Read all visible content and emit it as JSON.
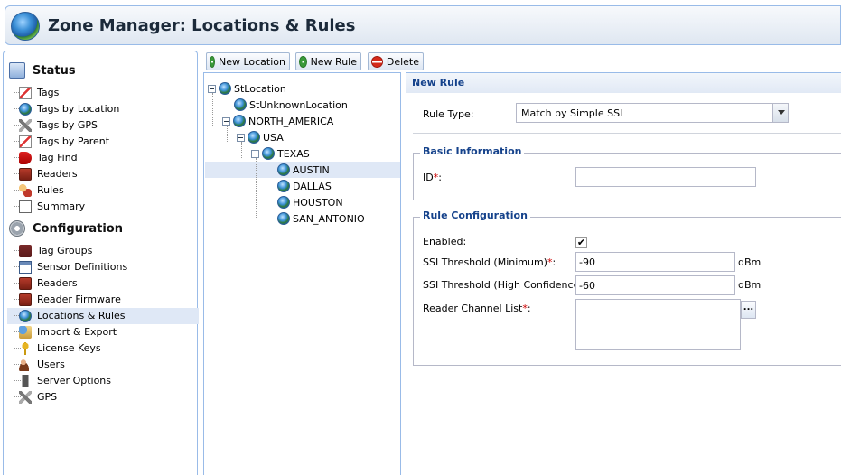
{
  "header": {
    "title": "Zone Manager: Locations & Rules",
    "logo_icon": "globe-icon"
  },
  "sidebar": {
    "status": {
      "title": "Status",
      "items": [
        {
          "label": "Tags",
          "icon": "tag-icon"
        },
        {
          "label": "Tags by Location",
          "icon": "globe-icon"
        },
        {
          "label": "Tags by GPS",
          "icon": "satellite-icon"
        },
        {
          "label": "Tags by Parent",
          "icon": "tag-icon"
        },
        {
          "label": "Tag Find",
          "icon": "tag-find-icon"
        },
        {
          "label": "Readers",
          "icon": "reader-icon"
        },
        {
          "label": "Rules",
          "icon": "rules-icon"
        },
        {
          "label": "Summary",
          "icon": "document-icon"
        }
      ]
    },
    "configuration": {
      "title": "Configuration",
      "items": [
        {
          "label": "Tag Groups",
          "icon": "tag-group-icon"
        },
        {
          "label": "Sensor Definitions",
          "icon": "sensor-icon"
        },
        {
          "label": "Readers",
          "icon": "reader-icon"
        },
        {
          "label": "Reader Firmware",
          "icon": "reader-icon"
        },
        {
          "label": "Locations & Rules",
          "icon": "globe-icon",
          "selected": true
        },
        {
          "label": "Import & Export",
          "icon": "import-export-icon"
        },
        {
          "label": "License Keys",
          "icon": "key-icon"
        },
        {
          "label": "Users",
          "icon": "users-icon"
        },
        {
          "label": "Server Options",
          "icon": "server-icon"
        },
        {
          "label": "GPS",
          "icon": "satellite-icon"
        }
      ]
    }
  },
  "toolbar": {
    "new_location_label": "New Location",
    "new_rule_label": "New Rule",
    "delete_label": "Delete"
  },
  "tree": {
    "root": "StLocation",
    "unknown": "StUnknownLocation",
    "north_america": "NORTH_AMERICA",
    "usa": "USA",
    "texas": "TEXAS",
    "cities": [
      "AUSTIN",
      "DALLAS",
      "HOUSTON",
      "SAN_ANTONIO"
    ],
    "selected": "AUSTIN"
  },
  "form": {
    "header": "New Rule",
    "rule_type_label": "Rule Type:",
    "rule_type_value": "Match by Simple SSI",
    "basic_info_title": "Basic Information",
    "id_label": "ID",
    "id_value": "",
    "rule_config_title": "Rule Configuration",
    "enabled_label": "Enabled:",
    "enabled_checked": "✔",
    "ssi_min_label": "SSI Threshold (Minimum)",
    "ssi_min_value": "-90",
    "ssi_min_unit": "dBm",
    "ssi_high_label": "SSI Threshold (High Confidence)",
    "ssi_high_value": "-60",
    "ssi_high_unit": "dBm",
    "channel_list_label": "Reader Channel List",
    "ellipsis": "...",
    "required_mark": "*",
    "colon": ":"
  },
  "colors": {
    "accent": "#15428b",
    "border": "#99bbe8",
    "selected_bg": "#dfe8f6"
  }
}
